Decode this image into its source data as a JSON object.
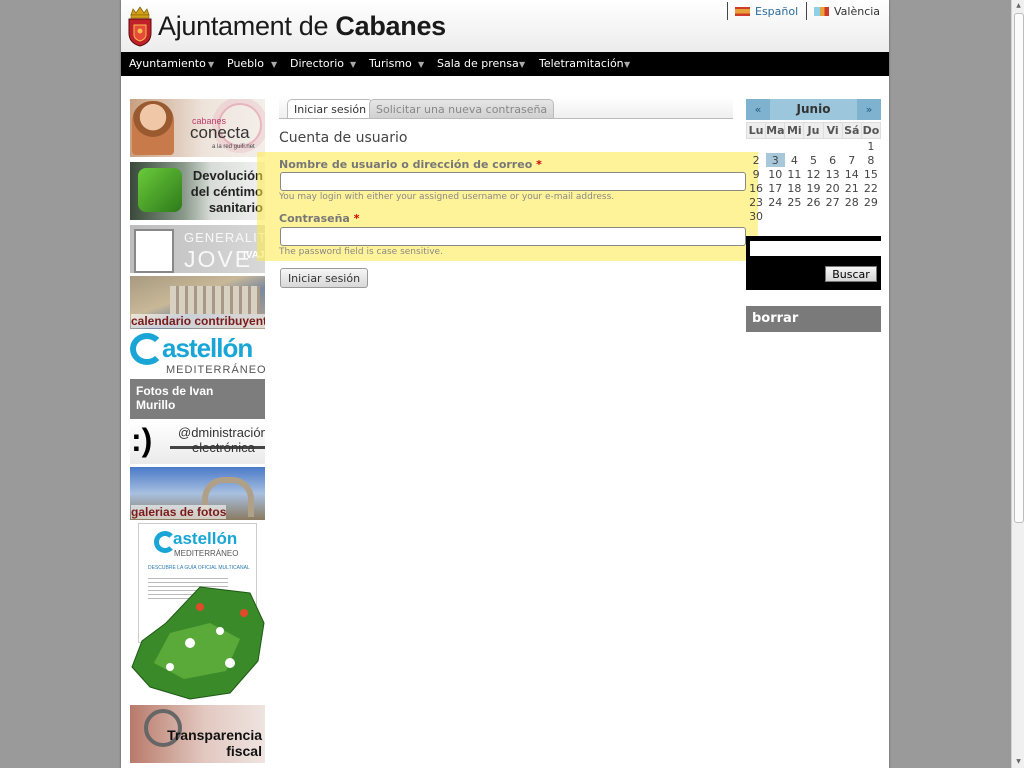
{
  "header": {
    "title_prefix": "Ajuntament de ",
    "title_bold": "Cabanes",
    "languages": [
      {
        "label": "Español",
        "flag_colors": [
          "#e8a23a",
          "#d03a2a"
        ]
      },
      {
        "label": "València",
        "flag_colors": [
          "#8fd0e8",
          "#e8a23a"
        ]
      }
    ]
  },
  "menu": [
    "Ayuntamiento",
    "Pueblo",
    "Directorio",
    "Turismo",
    "Sala de prensa",
    "Teletramitación"
  ],
  "banners": {
    "conecta": {
      "line1": "cabanes",
      "line2": "conecta",
      "line3": "a la red guifi.net"
    },
    "devolucion": {
      "line1": "Devolución",
      "line2": "del céntimo",
      "line3": "sanitario"
    },
    "jove": {
      "line1": "GENERALITAT",
      "line2": "JOVE",
      "line3": "IVAJ"
    },
    "calendario": {
      "label": "calendario contribuyente"
    },
    "castellon": {
      "line1": "astellón",
      "line2": "MEDITERRÁNEO"
    },
    "fotos_ivan": {
      "line1": "Fotos de Ivan",
      "line2": "Murillo"
    },
    "admin": {
      "smiley": ":)",
      "line1": "@dministración",
      "line2": "electrónica"
    },
    "galerias": {
      "label": "galerias de fotos"
    },
    "guia": {
      "line1": "astellón",
      "line2": "MEDITERRÁNEO",
      "line3": "DESCUBRE LA GUÍA OFICIAL MULTICANAL"
    },
    "transparencia": {
      "line1": "Transparencia",
      "line2": "fiscal"
    }
  },
  "tabs": {
    "login": "Iniciar sesión",
    "new_password": "Solicitar una nueva contraseña"
  },
  "form": {
    "section_title": "Cuenta de usuario",
    "username_label": "Nombre de usuario o dirección de correo",
    "username_desc": "You may login with either your assigned username or your e-mail address.",
    "username_value": "",
    "password_label": "Contraseña",
    "password_desc": "The password field is case sensitive.",
    "password_value": "",
    "required_mark": "*",
    "submit_label": "Iniciar sesión"
  },
  "calendar": {
    "prev": "«",
    "next": "»",
    "month": "Junio",
    "weekdays": [
      "Lu",
      "Ma",
      "Mi",
      "Ju",
      "Vi",
      "Sá",
      "Do"
    ],
    "weeks": [
      [
        "",
        "",
        "",
        "",
        "",
        "",
        "1"
      ],
      [
        "2",
        "3",
        "4",
        "5",
        "6",
        "7",
        "8"
      ],
      [
        "9",
        "10",
        "11",
        "12",
        "13",
        "14",
        "15"
      ],
      [
        "16",
        "17",
        "18",
        "19",
        "20",
        "21",
        "22"
      ],
      [
        "23",
        "24",
        "25",
        "26",
        "27",
        "28",
        "29"
      ],
      [
        "30",
        "",
        "",
        "",
        "",
        "",
        ""
      ]
    ],
    "today": "3"
  },
  "search": {
    "button_label": "Buscar",
    "value": ""
  },
  "block_borrar": "borrar",
  "colors": {
    "accent": "#9cc6dc",
    "highlight": "#ffea46",
    "menubar": "#000000"
  }
}
